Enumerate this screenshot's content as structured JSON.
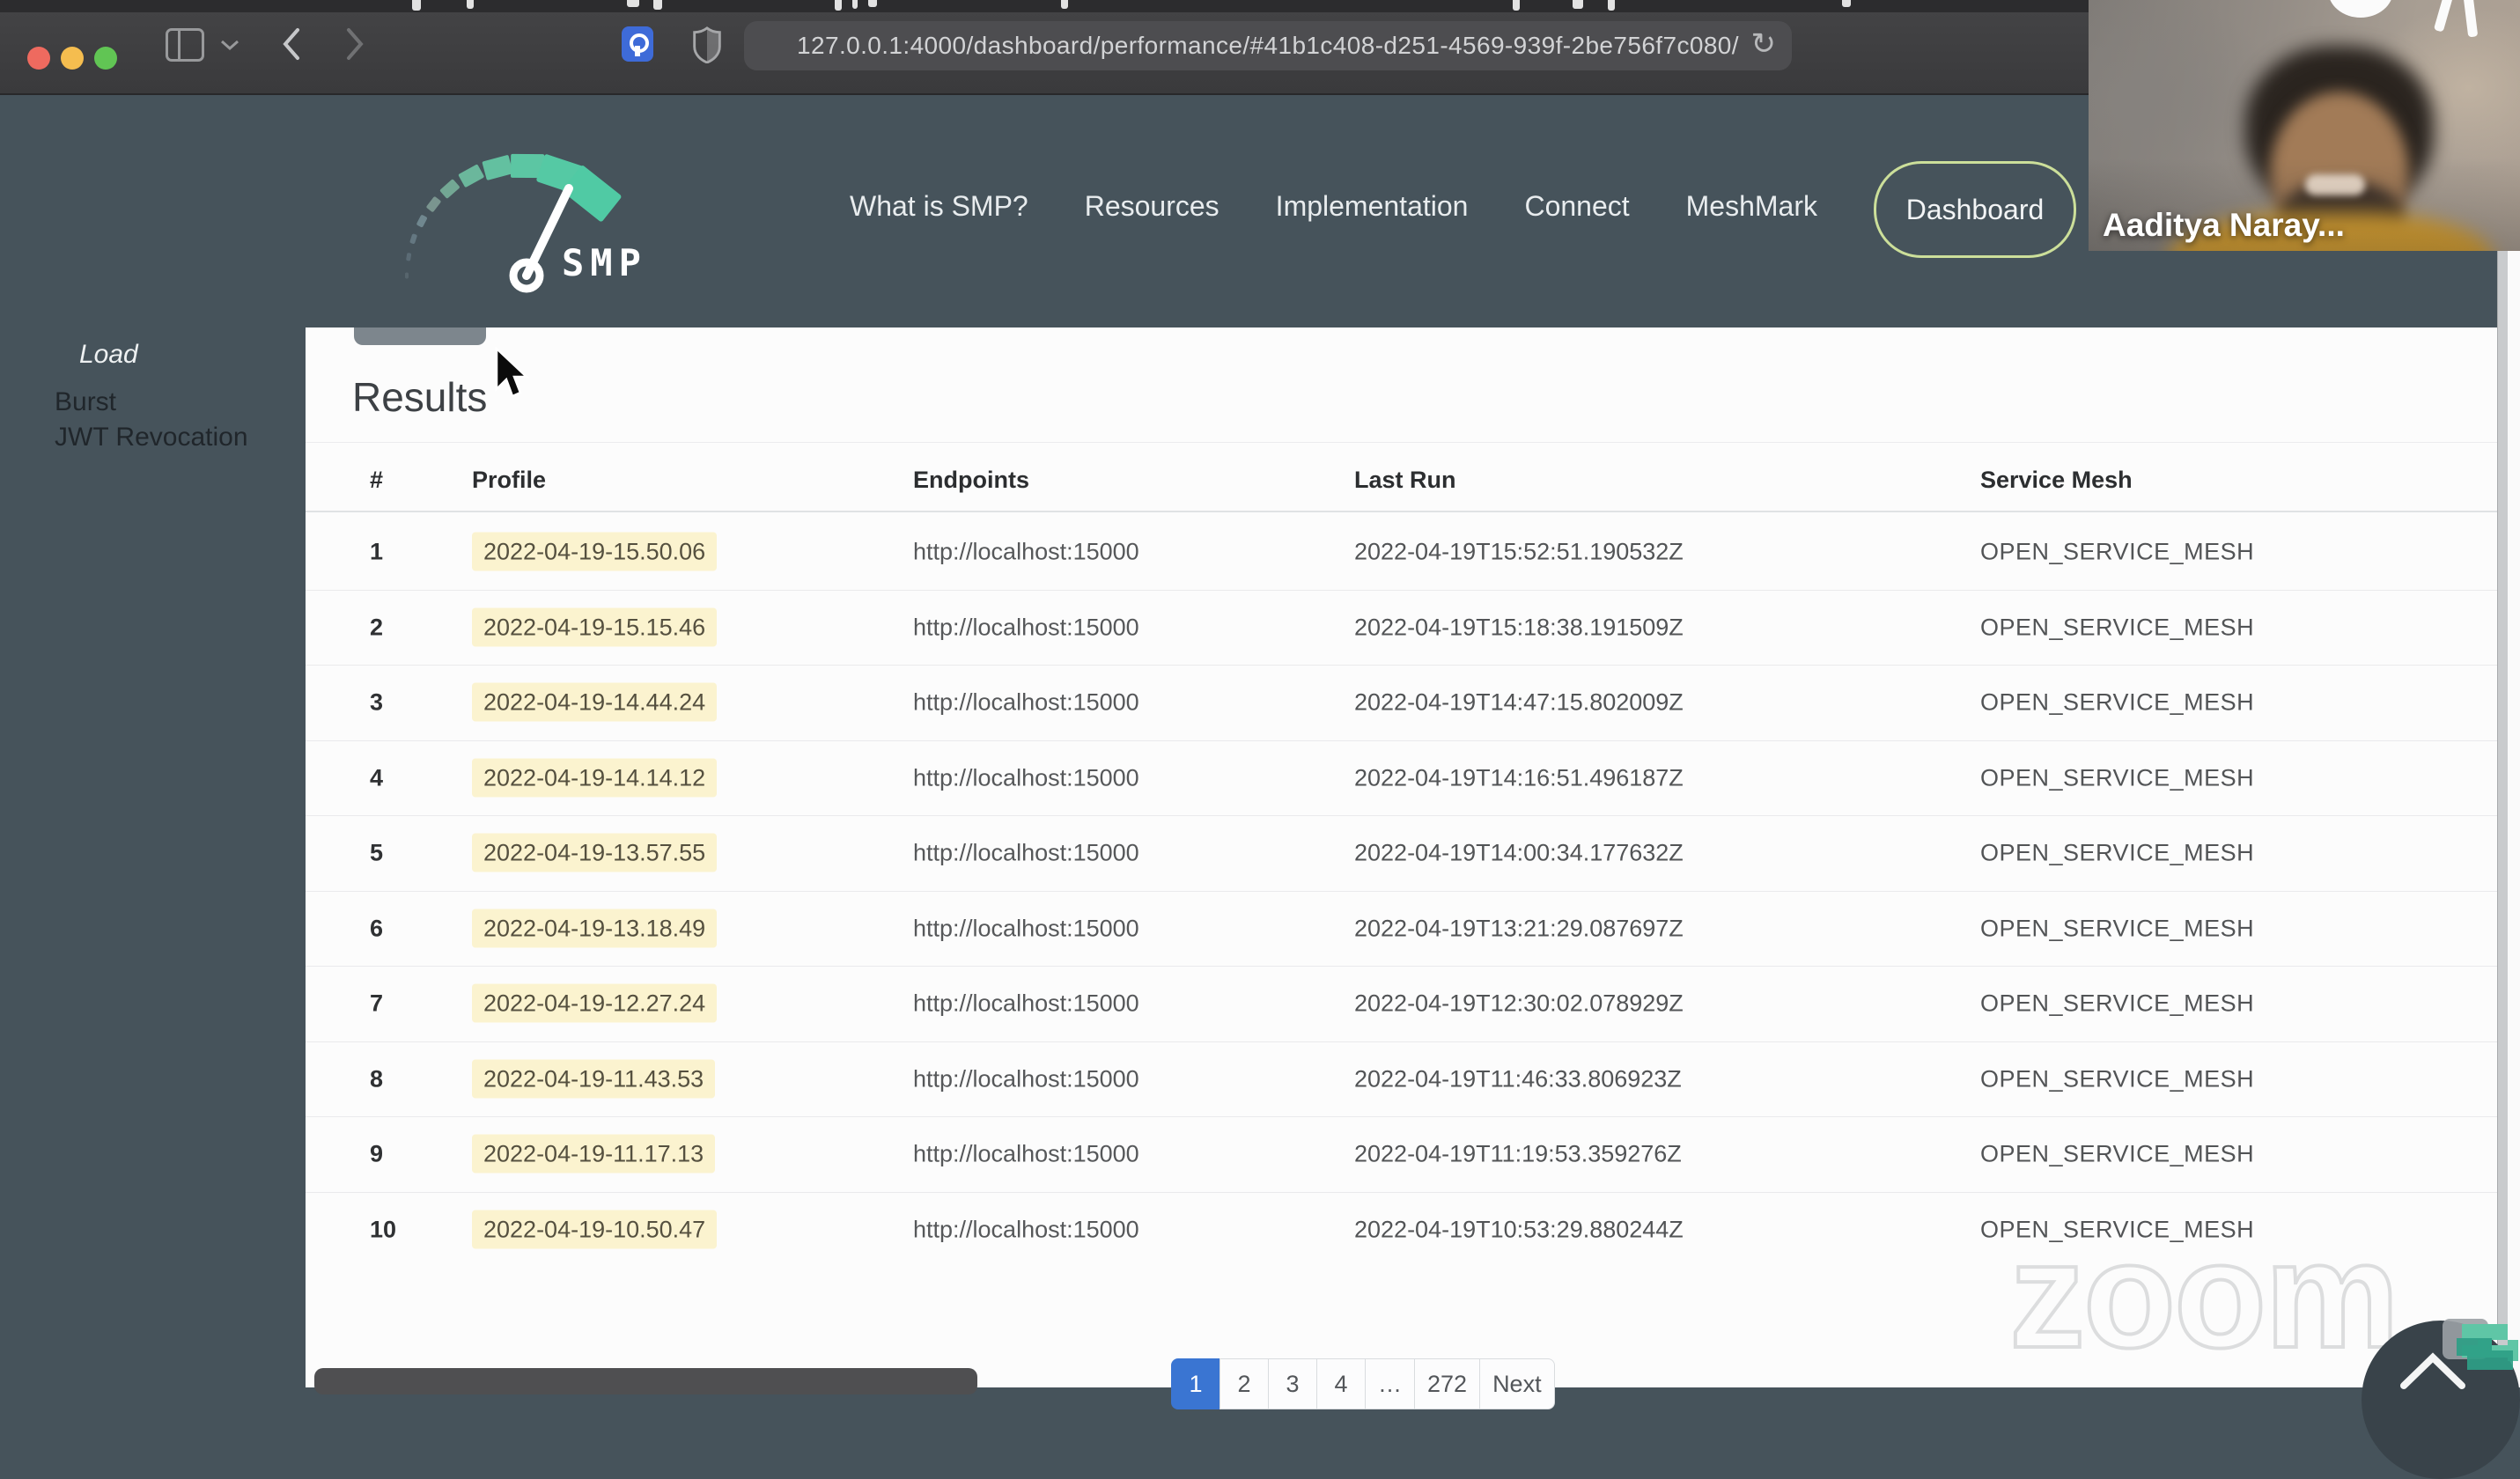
{
  "browser": {
    "url": "127.0.0.1:4000/dashboard/performance/#41b1c408-d251-4569-939f-2be756f7c080/",
    "reload_glyph": "↻"
  },
  "header": {
    "logo_text": "SMP",
    "links": [
      "What is SMP?",
      "Resources",
      "Implementation",
      "Connect",
      "MeshMark"
    ],
    "dashboard_label": "Dashboard"
  },
  "sidebar": {
    "items": [
      {
        "label": "Load",
        "state": "active"
      },
      {
        "label": "Burst",
        "state": "muted"
      },
      {
        "label": "JWT Revocation",
        "state": "muted"
      }
    ]
  },
  "results": {
    "title": "Results",
    "columns": [
      "#",
      "Profile",
      "Endpoints",
      "Last Run",
      "Service Mesh"
    ],
    "rows": [
      {
        "num": "1",
        "profile": "2022-04-19-15.50.06",
        "endpoints": "http://localhost:15000",
        "last_run": "2022-04-19T15:52:51.190532Z",
        "mesh": "OPEN_SERVICE_MESH"
      },
      {
        "num": "2",
        "profile": "2022-04-19-15.15.46",
        "endpoints": "http://localhost:15000",
        "last_run": "2022-04-19T15:18:38.191509Z",
        "mesh": "OPEN_SERVICE_MESH"
      },
      {
        "num": "3",
        "profile": "2022-04-19-14.44.24",
        "endpoints": "http://localhost:15000",
        "last_run": "2022-04-19T14:47:15.802009Z",
        "mesh": "OPEN_SERVICE_MESH"
      },
      {
        "num": "4",
        "profile": "2022-04-19-14.14.12",
        "endpoints": "http://localhost:15000",
        "last_run": "2022-04-19T14:16:51.496187Z",
        "mesh": "OPEN_SERVICE_MESH"
      },
      {
        "num": "5",
        "profile": "2022-04-19-13.57.55",
        "endpoints": "http://localhost:15000",
        "last_run": "2022-04-19T14:00:34.177632Z",
        "mesh": "OPEN_SERVICE_MESH"
      },
      {
        "num": "6",
        "profile": "2022-04-19-13.18.49",
        "endpoints": "http://localhost:15000",
        "last_run": "2022-04-19T13:21:29.087697Z",
        "mesh": "OPEN_SERVICE_MESH"
      },
      {
        "num": "7",
        "profile": "2022-04-19-12.27.24",
        "endpoints": "http://localhost:15000",
        "last_run": "2022-04-19T12:30:02.078929Z",
        "mesh": "OPEN_SERVICE_MESH"
      },
      {
        "num": "8",
        "profile": "2022-04-19-11.43.53",
        "endpoints": "http://localhost:15000",
        "last_run": "2022-04-19T11:46:33.806923Z",
        "mesh": "OPEN_SERVICE_MESH"
      },
      {
        "num": "9",
        "profile": "2022-04-19-11.17.13",
        "endpoints": "http://localhost:15000",
        "last_run": "2022-04-19T11:19:53.359276Z",
        "mesh": "OPEN_SERVICE_MESH"
      },
      {
        "num": "10",
        "profile": "2022-04-19-10.50.47",
        "endpoints": "http://localhost:15000",
        "last_run": "2022-04-19T10:53:29.880244Z",
        "mesh": "OPEN_SERVICE_MESH"
      }
    ]
  },
  "pagination": {
    "active": "1",
    "pages": [
      "1",
      "2",
      "3",
      "4",
      "…",
      "272"
    ],
    "next_label": "Next"
  },
  "webcam": {
    "name": "Aaditya Naray..."
  },
  "watermark": "zoom",
  "colors": {
    "header_teal": "#46535b",
    "active_page_blue": "#3a75d2",
    "profile_highlight": "#fbf3cf",
    "dashboard_border": "#ccdf9a",
    "logo_teal": "#55c9a4"
  }
}
